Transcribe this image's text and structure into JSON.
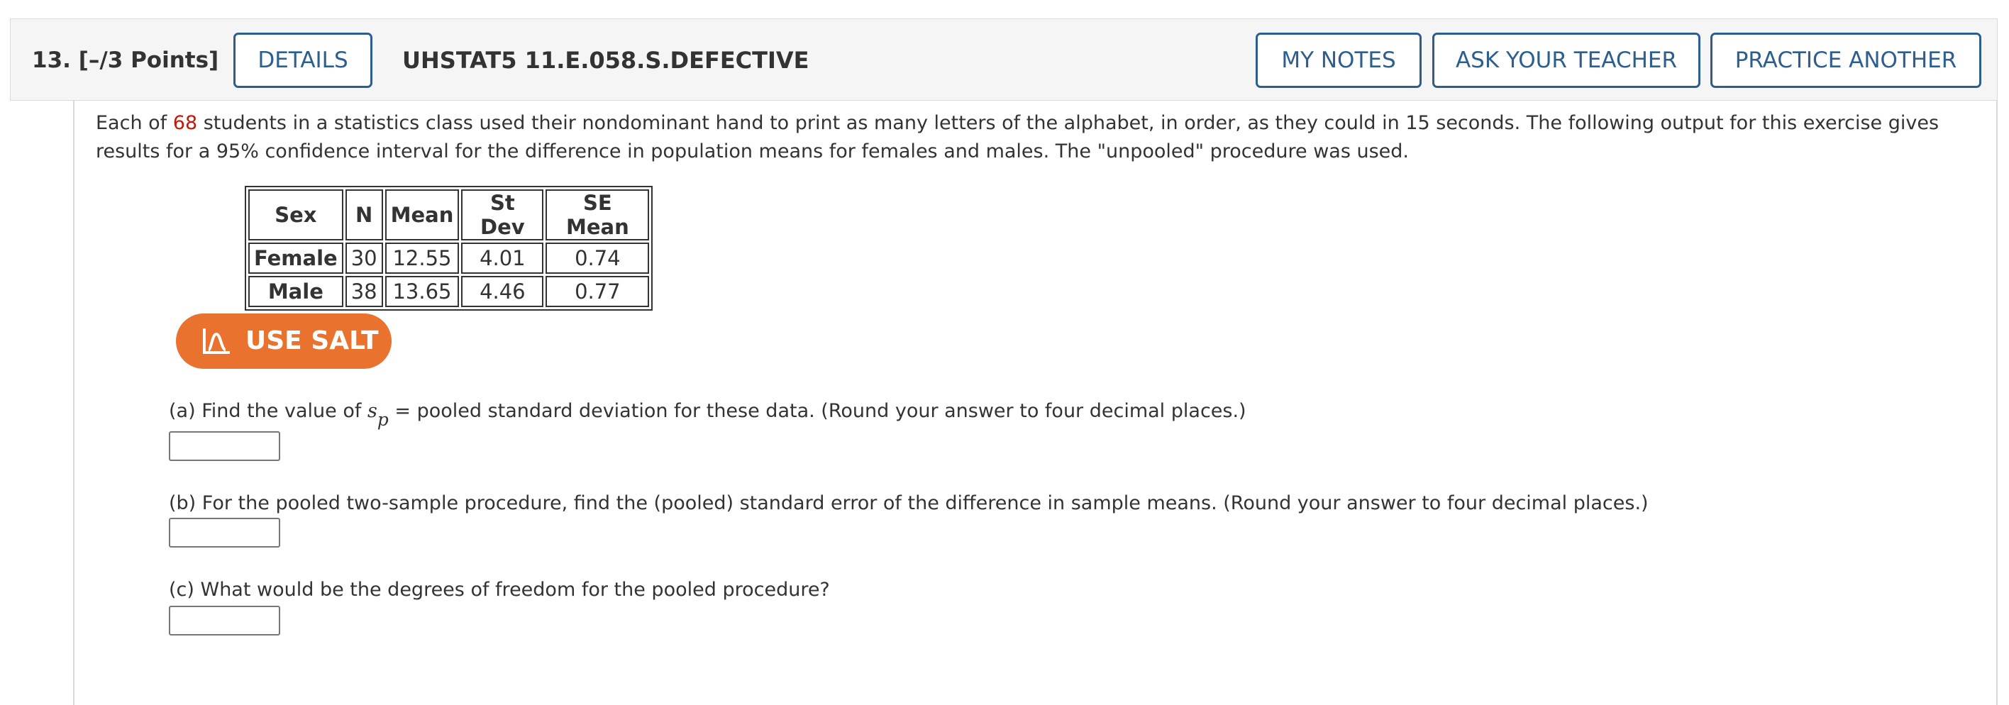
{
  "header": {
    "question_number": "13.",
    "points": "[–/3 Points]",
    "details_label": "DETAILS",
    "question_code": "UHSTAT5 11.E.058.S.DEFECTIVE",
    "my_notes_label": "MY NOTES",
    "ask_teacher_label": "ASK YOUR TEACHER",
    "practice_label": "PRACTICE ANOTHER"
  },
  "intro": {
    "part1": "Each of ",
    "num_students": "68",
    "part2": " students in a statistics class used their nondominant hand to print as many letters of the alphabet, in order, as they could in 15 seconds. The following output for this exercise gives results for a 95% confidence interval for the difference in population means for females and males. The \"unpooled\" procedure was used."
  },
  "table": {
    "headers": [
      "Sex",
      "N",
      "Mean",
      "St Dev",
      "SE Mean"
    ],
    "rows": [
      {
        "sex": "Female",
        "n": "30",
        "mean": "12.55",
        "stdev": "4.01",
        "semean": "0.74"
      },
      {
        "sex": "Male",
        "n": "38",
        "mean": "13.65",
        "stdev": "4.46",
        "semean": "0.77"
      }
    ]
  },
  "salt": {
    "label": "USE SALT"
  },
  "questions": {
    "a_prefix": "(a) Find the value of ",
    "a_var": "s",
    "a_sub": "p",
    "a_suffix": " = pooled standard deviation for these data. (Round your answer to four decimal places.)",
    "b": "(b) For the pooled two-sample procedure, find the (pooled) standard error of the difference in sample means. (Round your answer to four decimal places.)",
    "c": "(c) What would be the degrees of freedom for the pooled procedure?"
  },
  "answers": {
    "a": "",
    "b": "",
    "c": ""
  },
  "colors": {
    "accent": "#2e5e8e",
    "salt": "#e8722e",
    "highlight": "#c0180c"
  }
}
